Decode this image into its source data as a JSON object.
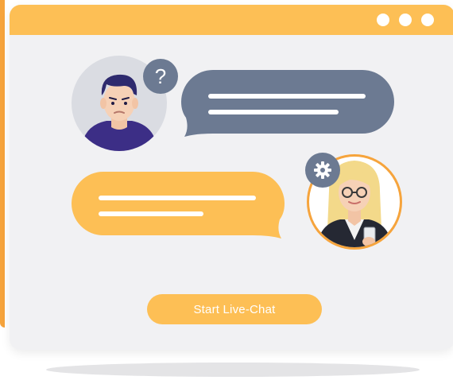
{
  "colors": {
    "accent_orange": "#F6A43C",
    "titlebar_yellow": "#FDBF55",
    "window_bg": "#F1F1F3",
    "agent_bubble": "#6C7A92",
    "user_bubble": "#FDBF55",
    "navy": "#3C2E86"
  },
  "icons": {
    "question_badge": "question-mark-icon",
    "support_badge": "gear-icon"
  },
  "question_glyph": "?",
  "cta": {
    "label": "Start Live-Chat"
  }
}
